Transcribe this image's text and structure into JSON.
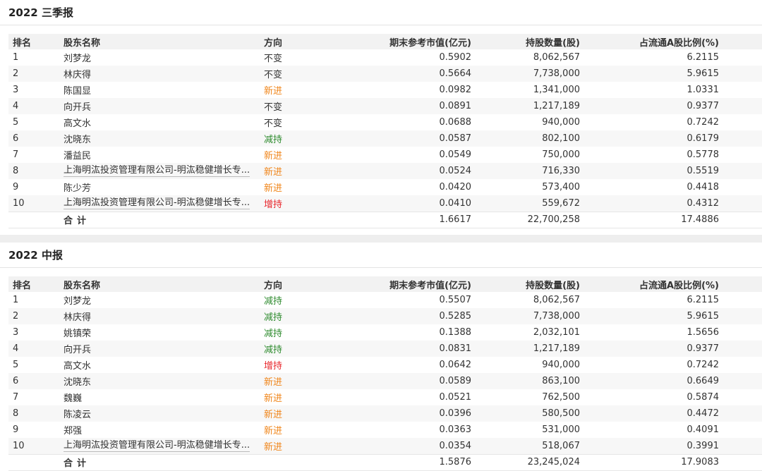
{
  "colors": {
    "unchanged": "#333333",
    "new": "#f08519",
    "decrease": "#2e8b2e",
    "increase": "#e8262b"
  },
  "columns": {
    "rank": "排名",
    "name": "股东名称",
    "direction": "方向",
    "market_value": "期末参考市值(亿元)",
    "shares": "持股数量(股)",
    "ratio": "占流通A股比例(%)"
  },
  "sections": [
    {
      "title": "2022 三季报",
      "rows": [
        {
          "rank": "1",
          "name": "刘梦龙",
          "direction": "不变",
          "dir_type": "unchanged",
          "market_value": "0.5902",
          "shares": "8,062,567",
          "ratio": "6.2115"
        },
        {
          "rank": "2",
          "name": "林庆得",
          "direction": "不变",
          "dir_type": "unchanged",
          "market_value": "0.5664",
          "shares": "7,738,000",
          "ratio": "5.9615"
        },
        {
          "rank": "3",
          "name": "陈国显",
          "direction": "新进",
          "dir_type": "new",
          "market_value": "0.0982",
          "shares": "1,341,000",
          "ratio": "1.0331"
        },
        {
          "rank": "4",
          "name": "向开兵",
          "direction": "不变",
          "dir_type": "unchanged",
          "market_value": "0.0891",
          "shares": "1,217,189",
          "ratio": "0.9377"
        },
        {
          "rank": "5",
          "name": "高文水",
          "direction": "不变",
          "dir_type": "unchanged",
          "market_value": "0.0688",
          "shares": "940,000",
          "ratio": "0.7242"
        },
        {
          "rank": "6",
          "name": "沈晓东",
          "direction": "减持",
          "dir_type": "decrease",
          "market_value": "0.0587",
          "shares": "802,100",
          "ratio": "0.6179"
        },
        {
          "rank": "7",
          "name": "潘益民",
          "direction": "新进",
          "dir_type": "new",
          "market_value": "0.0549",
          "shares": "750,000",
          "ratio": "0.5778"
        },
        {
          "rank": "8",
          "name": "上海明汯投资管理有限公司-明汯稳健增长专...",
          "direction": "新进",
          "dir_type": "new",
          "market_value": "0.0524",
          "shares": "716,330",
          "ratio": "0.5519",
          "link": true
        },
        {
          "rank": "9",
          "name": "陈少芳",
          "direction": "新进",
          "dir_type": "new",
          "market_value": "0.0420",
          "shares": "573,400",
          "ratio": "0.4418"
        },
        {
          "rank": "10",
          "name": "上海明汯投资管理有限公司-明汯稳健增长专...",
          "direction": "增持",
          "dir_type": "increase",
          "market_value": "0.0410",
          "shares": "559,672",
          "ratio": "0.4312",
          "link": true
        }
      ],
      "total": {
        "label": "合计",
        "market_value": "1.6617",
        "shares": "22,700,258",
        "ratio": "17.4886"
      }
    },
    {
      "title": "2022 中报",
      "rows": [
        {
          "rank": "1",
          "name": "刘梦龙",
          "direction": "减持",
          "dir_type": "decrease",
          "market_value": "0.5507",
          "shares": "8,062,567",
          "ratio": "6.2115"
        },
        {
          "rank": "2",
          "name": "林庆得",
          "direction": "减持",
          "dir_type": "decrease",
          "market_value": "0.5285",
          "shares": "7,738,000",
          "ratio": "5.9615"
        },
        {
          "rank": "3",
          "name": "姚镇荣",
          "direction": "减持",
          "dir_type": "decrease",
          "market_value": "0.1388",
          "shares": "2,032,101",
          "ratio": "1.5656"
        },
        {
          "rank": "4",
          "name": "向开兵",
          "direction": "减持",
          "dir_type": "decrease",
          "market_value": "0.0831",
          "shares": "1,217,189",
          "ratio": "0.9377"
        },
        {
          "rank": "5",
          "name": "高文水",
          "direction": "增持",
          "dir_type": "increase",
          "market_value": "0.0642",
          "shares": "940,000",
          "ratio": "0.7242"
        },
        {
          "rank": "6",
          "name": "沈晓东",
          "direction": "新进",
          "dir_type": "new",
          "market_value": "0.0589",
          "shares": "863,100",
          "ratio": "0.6649"
        },
        {
          "rank": "7",
          "name": "魏巍",
          "direction": "新进",
          "dir_type": "new",
          "market_value": "0.0521",
          "shares": "762,500",
          "ratio": "0.5874"
        },
        {
          "rank": "8",
          "name": "陈凌云",
          "direction": "新进",
          "dir_type": "new",
          "market_value": "0.0396",
          "shares": "580,500",
          "ratio": "0.4472"
        },
        {
          "rank": "9",
          "name": "郑强",
          "direction": "新进",
          "dir_type": "new",
          "market_value": "0.0363",
          "shares": "531,000",
          "ratio": "0.4091"
        },
        {
          "rank": "10",
          "name": "上海明汯投资管理有限公司-明汯稳健增长专...",
          "direction": "新进",
          "dir_type": "new",
          "market_value": "0.0354",
          "shares": "518,067",
          "ratio": "0.3991",
          "link": true
        }
      ],
      "total": {
        "label": "合计",
        "market_value": "1.5876",
        "shares": "23,245,024",
        "ratio": "17.9083"
      }
    }
  ]
}
